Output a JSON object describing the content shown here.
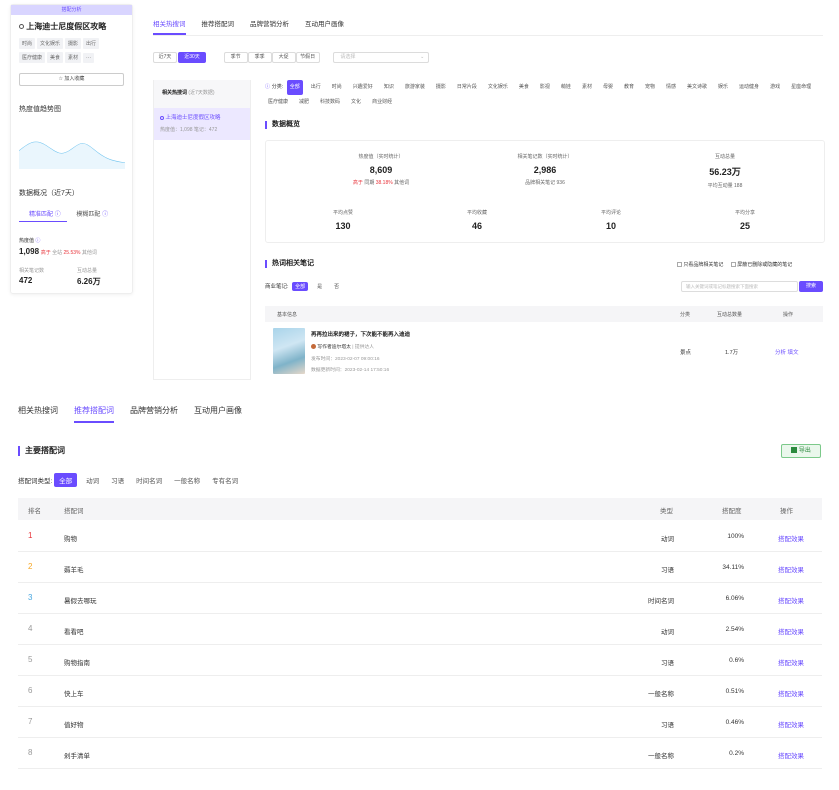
{
  "left": {
    "badge": "搭配分析",
    "title": "上海迪士尼度假区攻略",
    "tags": [
      "时尚",
      "文化娱乐",
      "摄影",
      "出行",
      "医疗健康",
      "美食",
      "素材",
      "···"
    ],
    "add_label": "加入收藏",
    "heat_title": "热度值趋势图",
    "overview_title": "数据概况（近7天）",
    "tab1": "精准匹配",
    "tab2": "模糊匹配",
    "heat_label": "热度值",
    "heat_value": "1,098",
    "heat_compare_pre": "高于",
    "heat_compare_mid": "全站",
    "heat_compare_pct": "25.53%",
    "heat_compare_post": "其他词",
    "notes_label": "相关笔记数",
    "notes_value": "472",
    "inter_label": "互动总量",
    "inter_value": "6.26万"
  },
  "top": {
    "tabs": [
      "相关热搜词",
      "推荐搭配词",
      "品牌营销分析",
      "互动用户画像"
    ],
    "days": [
      "近7天",
      "近30天"
    ],
    "seasons": [
      "季节",
      "季季",
      "大促",
      "节假日"
    ],
    "select_placeholder": "请选择",
    "hotword_title": "相关热搜词",
    "hotword_sub": "(近7天数据)",
    "hotword_item": "上海迪士尼度假区攻略",
    "hotword_stats": "热度值：1,098  笔记：472",
    "category_label": "分类:",
    "categories": [
      "全部",
      "出行",
      "时尚",
      "兴趣爱好",
      "知识",
      "旅游家装",
      "摄影",
      "日常片段",
      "文化娱乐",
      "美食",
      "影视",
      "萌娃",
      "素材",
      "母婴",
      "教育",
      "宠物",
      "情感",
      "美文诗歌",
      "娱乐",
      "运动健身",
      "游戏",
      "星座命理",
      "医疗健康",
      "减肥",
      "科技数码",
      "文化",
      "商业财经"
    ],
    "overview_title": "数据概览",
    "stats": [
      {
        "label": "热度值（实时统计）",
        "value": "8,609"
      },
      {
        "label": "相关笔记数（实时统计）",
        "value": "2,986",
        "sub": "品牌相关笔记 936"
      },
      {
        "label": "互动总量",
        "value": "56.23万",
        "sub": "平均互动量 188"
      },
      {
        "label": "平均点赞",
        "value": "130"
      },
      {
        "label": "平均收藏",
        "value": "46"
      },
      {
        "label": "平均评论",
        "value": "10"
      },
      {
        "label": "平均分享",
        "value": "25"
      }
    ],
    "stat_compare_pre": "高于",
    "stat_compare_mid": "同期",
    "stat_compare_pct": "38.18%",
    "stat_compare_post": "其他词",
    "notes_title": "热词相关笔记",
    "check1": "只看品牌相关笔记",
    "check2": "屏蔽已删除或隐藏的笔记",
    "business_label": "商业笔记:",
    "business_opts": [
      "全部",
      "是",
      "否"
    ],
    "search_placeholder": "输入关键词或笔记标题搜索下面搜索",
    "search_btn": "搜索",
    "th": [
      "基本信息",
      "分类",
      "互动总数量",
      "操作"
    ],
    "note": {
      "title": "再再拉出来的裙子，下次能不能再入迪迪",
      "author": "写作者迪尔塔太",
      "author_tag": "提供达人",
      "publish": "发布时间：2023-02-07 09:00:16",
      "update": "数据更新时间：2023-02-14 17:50:16",
      "category": "景点",
      "total": "1.7万",
      "op1": "分析",
      "op2": "填文"
    }
  },
  "bottom": {
    "tabs": [
      "相关热搜词",
      "推荐搭配词",
      "品牌营销分析",
      "互动用户画像"
    ],
    "title": "主要搭配词",
    "export": "导出",
    "type_label": "搭配词类型:",
    "types": [
      "全部",
      "动词",
      "习语",
      "时间名词",
      "一般名称",
      "专有名词"
    ],
    "th": [
      "排名",
      "搭配词",
      "类型",
      "搭配度",
      "操作"
    ],
    "rows": [
      {
        "rank": "1",
        "word": "购物",
        "type": "动词",
        "degree": "100%",
        "op": "搭配效果"
      },
      {
        "rank": "2",
        "word": "薅羊毛",
        "type": "习语",
        "degree": "34.11%",
        "op": "搭配效果"
      },
      {
        "rank": "3",
        "word": "暑假去哪玩",
        "type": "时间名词",
        "degree": "6.06%",
        "op": "搭配效果"
      },
      {
        "rank": "4",
        "word": "看看吧",
        "type": "动词",
        "degree": "2.54%",
        "op": "搭配效果"
      },
      {
        "rank": "5",
        "word": "购物指南",
        "type": "习语",
        "degree": "0.6%",
        "op": "搭配效果"
      },
      {
        "rank": "6",
        "word": "快上车",
        "type": "一般名称",
        "degree": "0.51%",
        "op": "搭配效果"
      },
      {
        "rank": "7",
        "word": "值好物",
        "type": "习语",
        "degree": "0.46%",
        "op": "搭配效果"
      },
      {
        "rank": "8",
        "word": "剁手清单",
        "type": "一般名称",
        "degree": "0.2%",
        "op": "搭配效果"
      }
    ],
    "rank_colors": [
      "#e8333a",
      "#f5a623",
      "#4aa8e0",
      "#999",
      "#999",
      "#999",
      "#999",
      "#999"
    ]
  }
}
